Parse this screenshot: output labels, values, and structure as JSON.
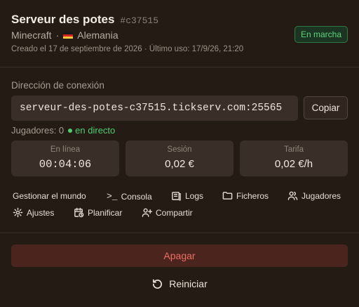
{
  "server": {
    "name": "Serveur des potes",
    "id": "#c37515",
    "game": "Minecraft",
    "separator": "·",
    "location": "Alemania",
    "flag_icon": "germany-flag-icon",
    "created": "Creado el 17 de septiembre de 2026 · Último uso: 17/9/26, 21:20",
    "status": "En marcha",
    "status_color": "#5fd47e"
  },
  "connection": {
    "label": "Dirección de conexión",
    "address": "serveur-des-potes-c37515.tickserv.com:25565",
    "copy_label": "Copiar"
  },
  "players": {
    "text": "Jugadores: 0",
    "live_label": "en directo",
    "live_color": "#4fcc6f"
  },
  "stats": [
    {
      "label": "En línea",
      "value": "00:04:06"
    },
    {
      "label": "Sesión",
      "value": "0,02 €"
    },
    {
      "label": "Tarifa",
      "value": "0,02 €/h"
    }
  ],
  "actions": [
    {
      "label": "Gestionar el mundo",
      "icon": "none"
    },
    {
      "label": "Consola",
      "icon": "terminal-icon"
    },
    {
      "label": "Logs",
      "icon": "logs-icon"
    },
    {
      "label": "Ficheros",
      "icon": "folder-icon"
    },
    {
      "label": "Jugadores",
      "icon": "users-icon"
    },
    {
      "label": "Ajustes",
      "icon": "gear-icon"
    },
    {
      "label": "Planificar",
      "icon": "calendar-clock-icon"
    },
    {
      "label": "Compartir",
      "icon": "user-plus-icon"
    }
  ],
  "buttons": {
    "shutdown": "Apagar",
    "shutdown_color": "#ec6e64",
    "restart": "Reiniciar",
    "restart_icon": "restart-icon"
  }
}
